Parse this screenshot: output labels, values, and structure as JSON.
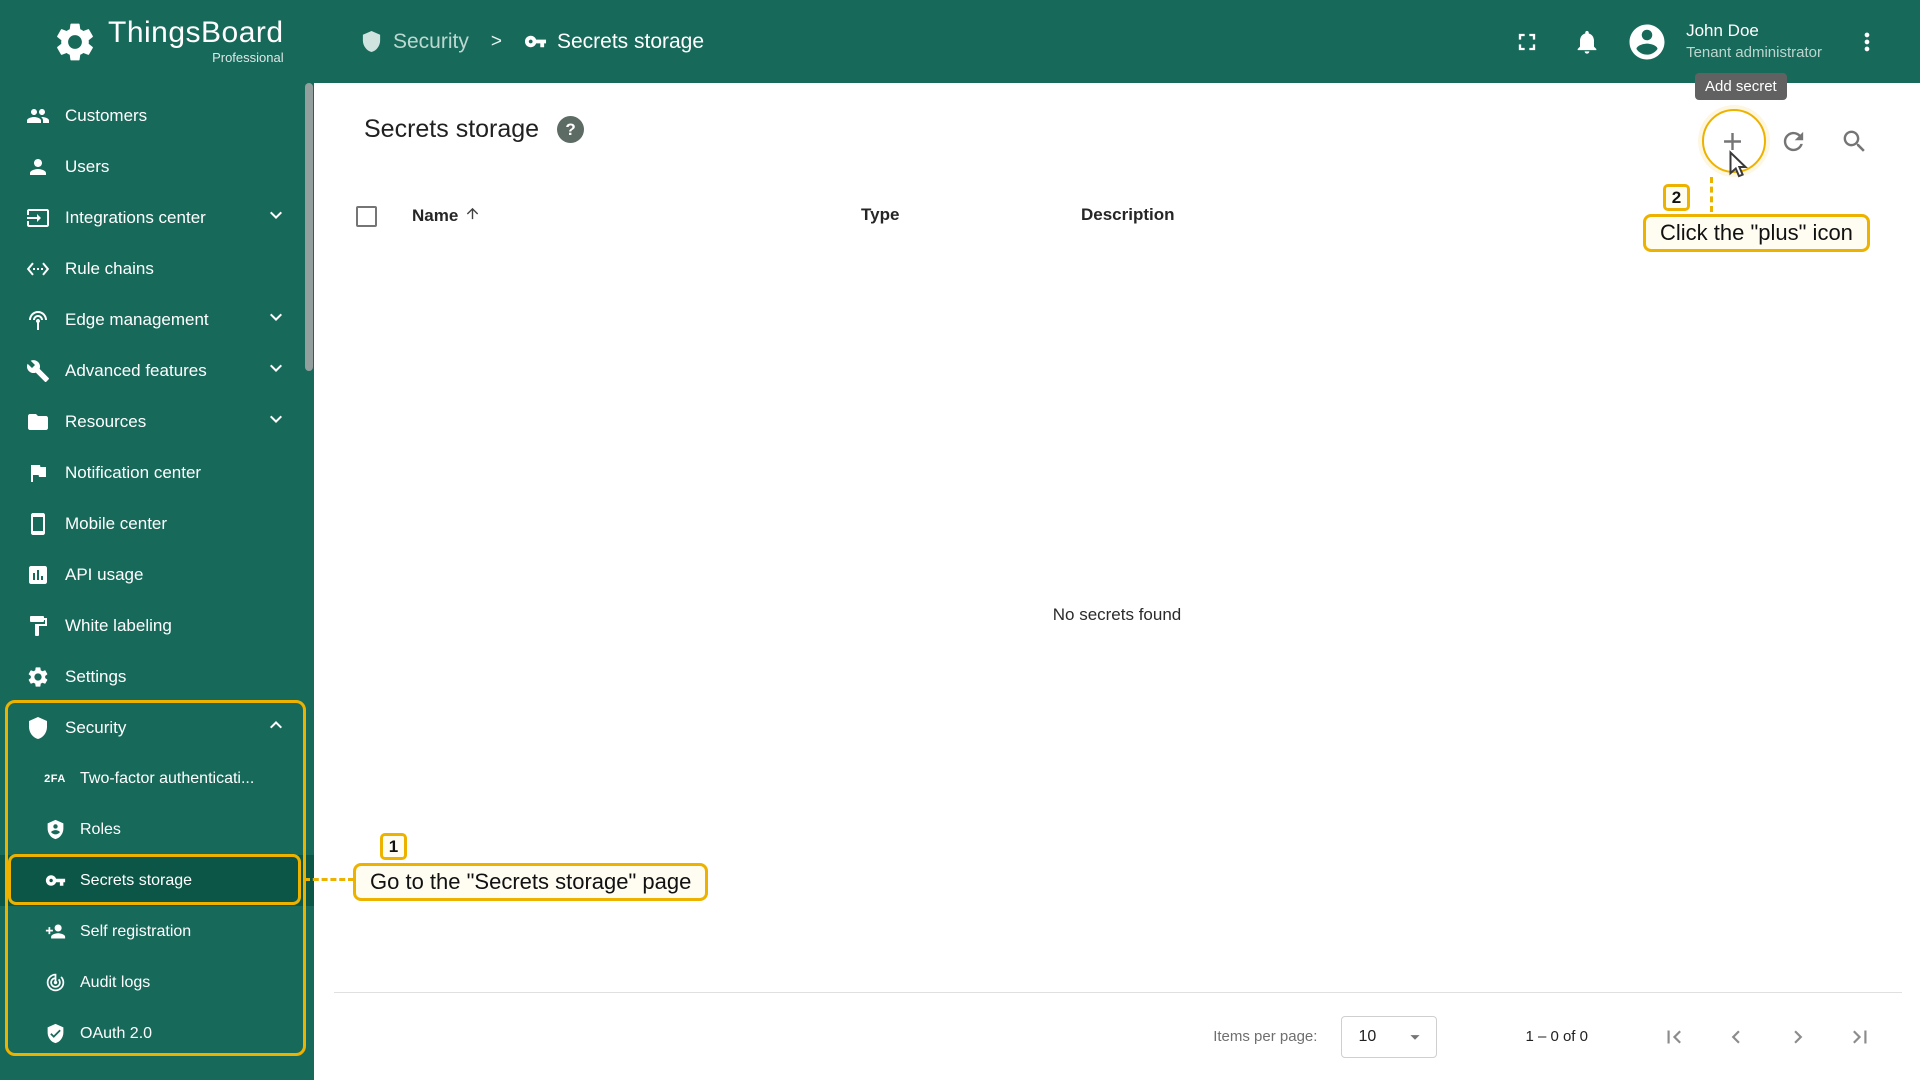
{
  "app": {
    "name": "ThingsBoard",
    "edition": "Professional"
  },
  "header": {
    "breadcrumb": {
      "section": "Security",
      "separator": ">",
      "current": "Secrets storage"
    },
    "user": {
      "name": "John Doe",
      "role": "Tenant administrator"
    },
    "tooltip": "Add secret"
  },
  "sidebar": {
    "items": [
      {
        "label": "Customers"
      },
      {
        "label": "Users"
      },
      {
        "label": "Integrations center"
      },
      {
        "label": "Rule chains"
      },
      {
        "label": "Edge management"
      },
      {
        "label": "Advanced features"
      },
      {
        "label": "Resources"
      },
      {
        "label": "Notification center"
      },
      {
        "label": "Mobile center"
      },
      {
        "label": "API usage"
      },
      {
        "label": "White labeling"
      },
      {
        "label": "Settings"
      },
      {
        "label": "Security"
      }
    ],
    "security_submenu": [
      {
        "label": "Two-factor authenticati..."
      },
      {
        "label": "Roles"
      },
      {
        "label": "Secrets storage"
      },
      {
        "label": "Self registration"
      },
      {
        "label": "Audit logs"
      },
      {
        "label": "OAuth 2.0"
      }
    ]
  },
  "main": {
    "title": "Secrets storage",
    "help_glyph": "?",
    "table": {
      "columns": [
        "Name",
        "Type",
        "Description"
      ]
    },
    "empty_text": "No secrets found",
    "paginator": {
      "items_per_page_label": "Items per page:",
      "items_per_page_value": "10",
      "range": "1 – 0 of 0"
    }
  },
  "annotations": {
    "step1": {
      "number": "1",
      "text": "Go to the \"Secrets storage\" page"
    },
    "step2": {
      "number": "2",
      "text": "Click the \"plus\" icon"
    }
  },
  "colors": {
    "primary": "#17695a",
    "selected": "#0b5647",
    "accent": "#edb200",
    "tooltip_bg": "#616161"
  }
}
